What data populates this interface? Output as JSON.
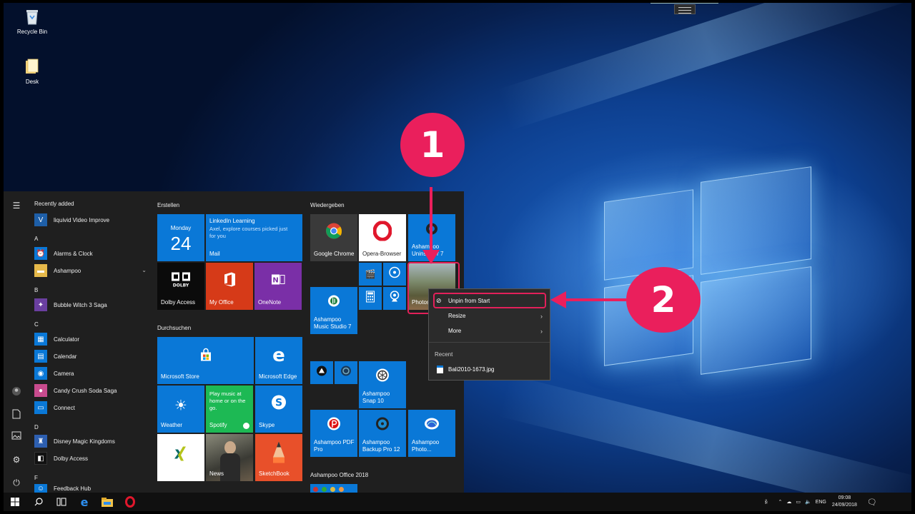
{
  "desktop": {
    "icons": [
      {
        "label": "Recycle Bin",
        "icon": "recycle-bin-icon"
      },
      {
        "label": "Desk",
        "icon": "folder-icon"
      }
    ]
  },
  "start_menu": {
    "app_list": {
      "recently_added_heading": "Recently added",
      "items": [
        {
          "label": "liquivid Video Improve",
          "color": "#1e5fa8"
        },
        {
          "letter": "A"
        },
        {
          "label": "Alarms & Clock",
          "color": "#0a78d7"
        },
        {
          "label": "Ashampoo",
          "color": "#e6b94a"
        },
        {
          "letter": "B"
        },
        {
          "label": "Bubble Witch 3 Saga",
          "color": "#6a3fa0"
        },
        {
          "letter": "C"
        },
        {
          "label": "Calculator",
          "color": "#0a78d7"
        },
        {
          "label": "Calendar",
          "color": "#0a78d7"
        },
        {
          "label": "Camera",
          "color": "#0a78d7"
        },
        {
          "label": "Candy Crush Soda Saga",
          "color": "#c84b8e"
        },
        {
          "label": "Connect",
          "color": "#0a78d7"
        },
        {
          "letter": "D"
        },
        {
          "label": "Disney Magic Kingdoms",
          "color": "#2d5fb0"
        },
        {
          "label": "Dolby Access",
          "color": "#111111"
        },
        {
          "letter": "F"
        },
        {
          "label": "Feedback Hub",
          "color": "#0a78d7"
        }
      ]
    },
    "groups": {
      "erstellen": "Erstellen",
      "durchsuchen": "Durchsuchen",
      "wiedergeben": "Wiedergeben",
      "office": "Ashampoo Office 2018"
    },
    "tiles": {
      "calendar_day": "Monday",
      "calendar_date": "24",
      "linkedin_title": "LinkedIn Learning",
      "linkedin_text": "Axel, explore courses picked just for you",
      "mail": "Mail",
      "dolby": "Dolby Access",
      "myoffice": "My Office",
      "onenote": "OneNote",
      "store": "Microsoft Store",
      "edge": "Microsoft Edge",
      "weather": "Weather",
      "spotify_text": "Play music at home or on the go.",
      "spotify": "Spotify",
      "skype": "Skype",
      "news": "News",
      "sketchbook": "SketchBook",
      "chrome": "Google Chrome",
      "opera": "Opera-Browser",
      "uninstaller": "Ashampoo Uninstaller 7",
      "photos": "Photos",
      "music_studio": "Ashampoo Music Studio 7",
      "snap": "Ashampoo Snap 10",
      "pdf_pro": "Ashampoo PDF Pro",
      "backup": "Ashampoo Backup Pro 12",
      "photo_opt": "Ashampoo Photo..."
    }
  },
  "context_menu": {
    "unpin": "Unpin from Start",
    "resize": "Resize",
    "more": "More",
    "recent_heading": "Recent",
    "recent_file": "Bali2010-1673.jpg"
  },
  "annotations": {
    "step1": "1",
    "step2": "2",
    "color": "#ea1f5c"
  },
  "taskbar": {
    "language": "ENG",
    "time": "09:08",
    "date": "24/09/2018"
  }
}
